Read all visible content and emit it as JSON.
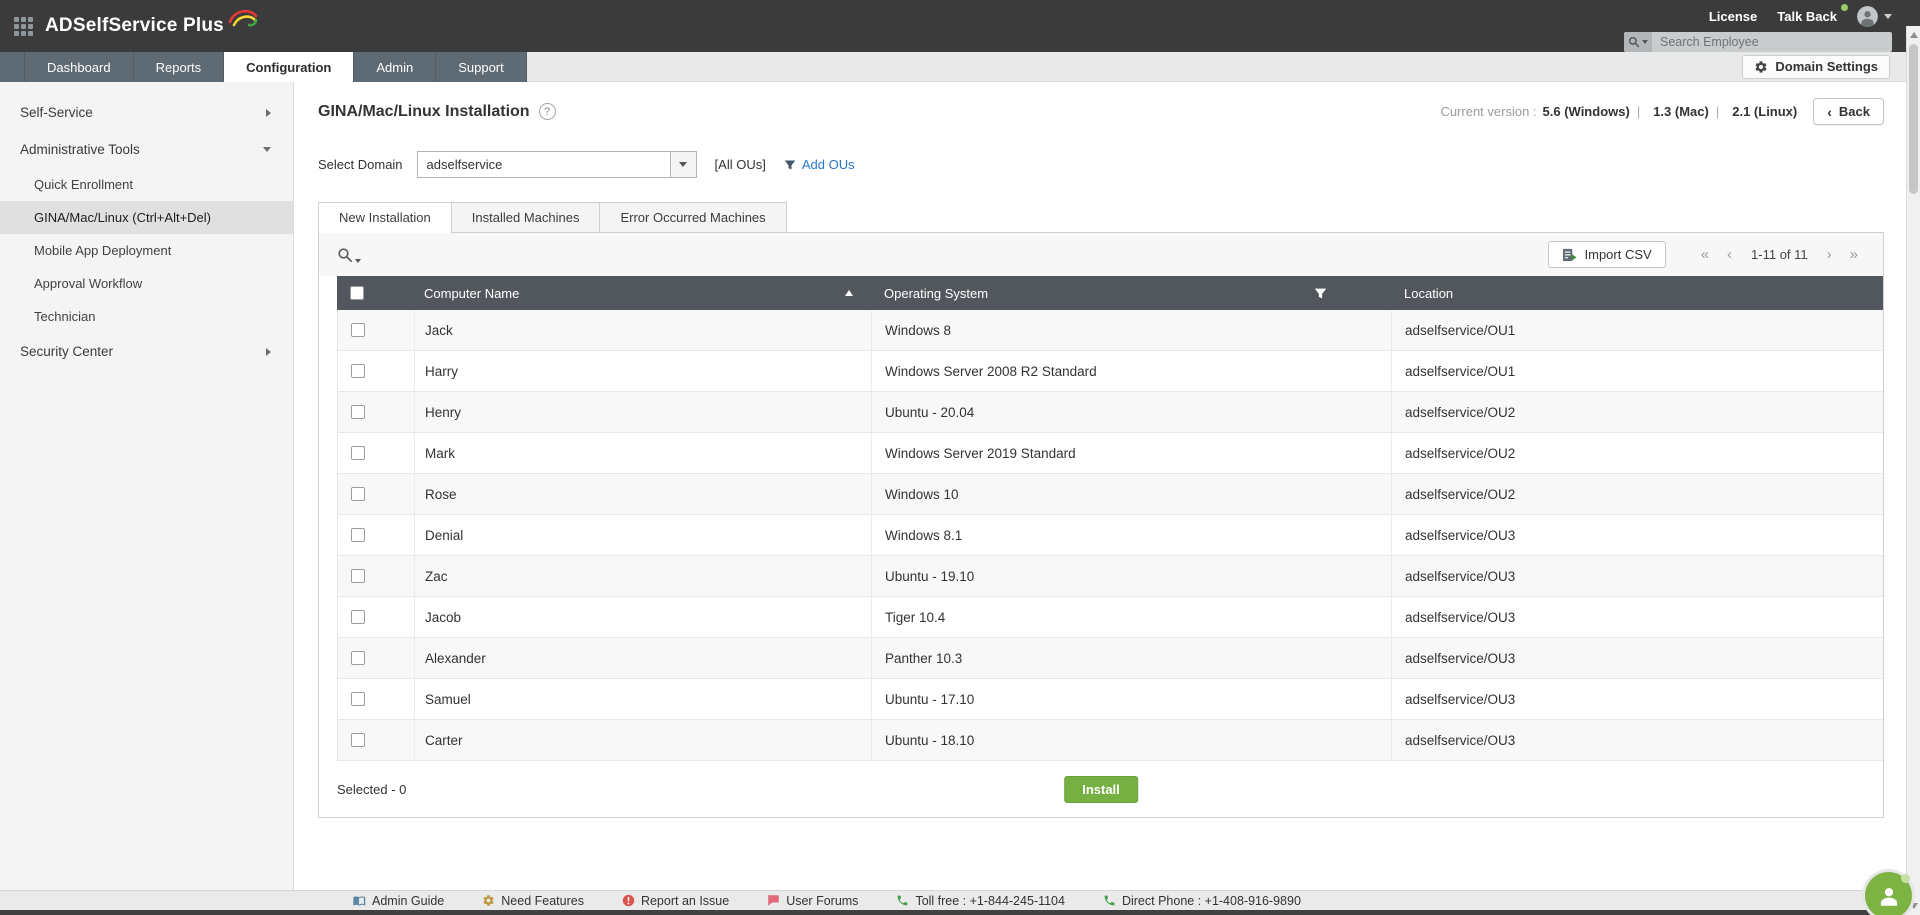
{
  "topbar": {
    "logo_text": "ADSelfService Plus",
    "license_label": "License",
    "talkback_label": "Talk Back",
    "search_placeholder": "Search Employee"
  },
  "nav": {
    "tabs": [
      "Dashboard",
      "Reports",
      "Configuration",
      "Admin",
      "Support"
    ],
    "active_tab": "Configuration",
    "domain_settings_label": "Domain Settings"
  },
  "sidebar": {
    "items": [
      {
        "label": "Self-Service"
      },
      {
        "label": "Administrative Tools"
      },
      {
        "label": "Quick Enrollment"
      },
      {
        "label": "GINA/Mac/Linux (Ctrl+Alt+Del)"
      },
      {
        "label": "Mobile App Deployment"
      },
      {
        "label": "Approval Workflow"
      },
      {
        "label": "Technician"
      },
      {
        "label": "Security Center"
      }
    ],
    "active_item": "GINA/Mac/Linux (Ctrl+Alt+Del)"
  },
  "main": {
    "title": "GINA/Mac/Linux Installation",
    "current_version_label": "Current version :",
    "version_windows": "5.6 (Windows)",
    "version_mac": "1.3 (Mac)",
    "version_linux": "2.1 (Linux)",
    "version_separator": "|",
    "back_label": "Back",
    "select_domain_label": "Select Domain",
    "domain_value": "adselfservice",
    "all_ous_label": "[All OUs]",
    "add_ous_label": "Add OUs",
    "tabs": [
      "New Installation",
      "Installed Machines",
      "Error Occurred Machines"
    ],
    "active_tab": "New Installation",
    "import_csv_label": "Import CSV",
    "pagination_text": "1-11 of 11",
    "table": {
      "headers": {
        "computer_name": "Computer Name",
        "operating_system": "Operating System",
        "location": "Location"
      },
      "rows": [
        {
          "name": "Jack",
          "os": "Windows 8",
          "location": "adselfservice/OU1"
        },
        {
          "name": "Harry",
          "os": "Windows Server 2008 R2 Standard",
          "location": "adselfservice/OU1"
        },
        {
          "name": "Henry",
          "os": "Ubuntu - 20.04",
          "location": "adselfservice/OU2"
        },
        {
          "name": "Mark",
          "os": "Windows Server 2019 Standard",
          "location": "adselfservice/OU2"
        },
        {
          "name": "Rose",
          "os": "Windows 10",
          "location": "adselfservice/OU2"
        },
        {
          "name": "Denial",
          "os": "Windows 8.1",
          "location": "adselfservice/OU3"
        },
        {
          "name": "Zac",
          "os": "Ubuntu - 19.10",
          "location": "adselfservice/OU3"
        },
        {
          "name": "Jacob",
          "os": "Tiger 10.4",
          "location": "adselfservice/OU3"
        },
        {
          "name": "Alexander",
          "os": "Panther 10.3",
          "location": "adselfservice/OU3"
        },
        {
          "name": "Samuel",
          "os": "Ubuntu - 17.10",
          "location": "adselfservice/OU3"
        },
        {
          "name": "Carter",
          "os": "Ubuntu - 18.10",
          "location": "adselfservice/OU3"
        }
      ]
    },
    "selected_label": "Selected - 0",
    "install_label": "Install"
  },
  "footer": {
    "admin_guide": "Admin Guide",
    "need_features": "Need Features",
    "report_issue": "Report an Issue",
    "user_forums": "User Forums",
    "toll_free": "Toll free : +1-844-245-1104",
    "direct_phone": "Direct Phone : +1-408-916-9890"
  },
  "colors": {
    "accent_green": "#76b043",
    "topbar_dark": "#3b3b3b",
    "nav_slate": "#5e6a74",
    "table_header": "#51575d",
    "link_blue": "#2677c9"
  }
}
